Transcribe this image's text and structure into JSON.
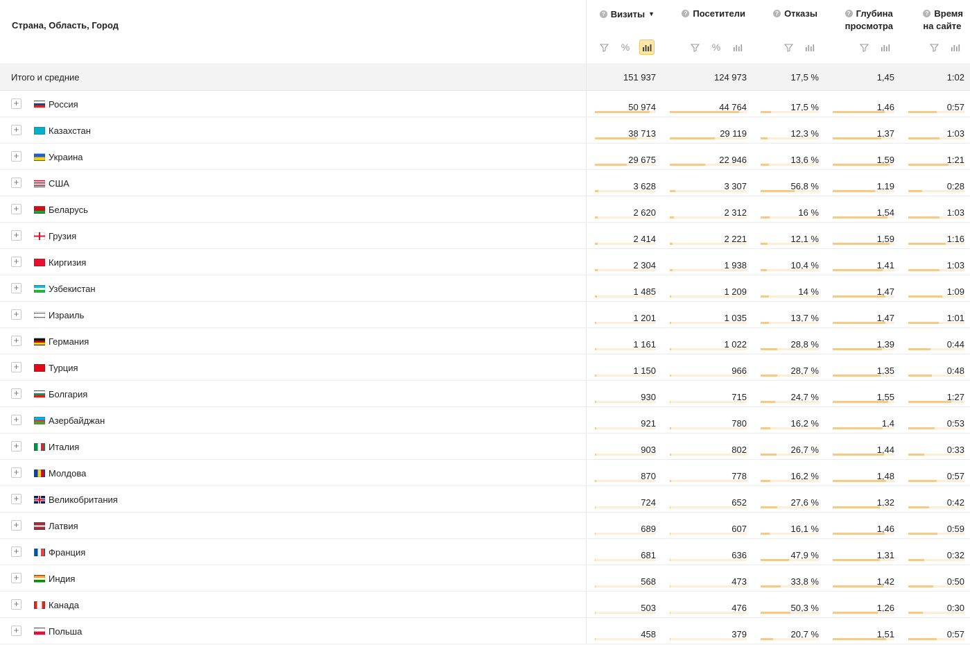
{
  "header": {
    "dimension_label": "Страна, Область, Город",
    "metrics": [
      {
        "label": "Визиты",
        "help_icon": "help-icon",
        "sort_icon": "sort-desc-icon",
        "tools": [
          "filter-icon",
          "percent-icon",
          "bar-chart-icon"
        ],
        "active_tool": "bar-chart-icon"
      },
      {
        "label": "Посетители",
        "help_icon": "help-icon",
        "tools": [
          "filter-icon",
          "percent-icon",
          "bar-chart-icon"
        ]
      },
      {
        "label": "Отказы",
        "help_icon": "help-icon",
        "tools": [
          "filter-icon",
          "bar-chart-icon"
        ]
      },
      {
        "label_line1": "Глубина",
        "label_line2": "просмотра",
        "help_icon": "help-icon",
        "tools": [
          "filter-icon",
          "bar-chart-icon"
        ]
      },
      {
        "label_line1": "Время",
        "label_line2": "на сайте",
        "help_icon": "help-icon",
        "tools": [
          "filter-icon",
          "bar-chart-icon"
        ]
      }
    ]
  },
  "totals": {
    "label": "Итого и средние",
    "values": [
      "151 937",
      "124 973",
      "17,5 %",
      "1,45",
      "1:02"
    ]
  },
  "colors": {
    "bar_fill": "#f1c992",
    "bar_track": "#fbeedb",
    "active_tool_bg": "#fde7a6",
    "totals_bg": "#f3f3f3"
  },
  "rows": [
    {
      "country": "Россия",
      "flag": "flag-ru",
      "values": [
        "50 974",
        "44 764",
        "17,5 %",
        "1,46",
        "0:57"
      ],
      "bars": [
        0.9,
        0.9,
        0.18,
        0.84,
        0.5
      ]
    },
    {
      "country": "Казахстан",
      "flag": "flag-kz",
      "values": [
        "38 713",
        "29 119",
        "12,3 %",
        "1,37",
        "1:03"
      ],
      "bars": [
        0.68,
        0.59,
        0.12,
        0.79,
        0.56
      ]
    },
    {
      "country": "Украина",
      "flag": "flag-ua",
      "values": [
        "29 675",
        "22 946",
        "13,6 %",
        "1,59",
        "1:21"
      ],
      "bars": [
        0.52,
        0.46,
        0.14,
        0.92,
        0.72
      ]
    },
    {
      "country": "США",
      "flag": "flag-us",
      "values": [
        "3 628",
        "3 307",
        "56,8 %",
        "1,19",
        "0:28"
      ],
      "bars": [
        0.06,
        0.07,
        0.58,
        0.69,
        0.25
      ]
    },
    {
      "country": "Беларусь",
      "flag": "flag-by",
      "values": [
        "2 620",
        "2 312",
        "16 %",
        "1,54",
        "1:03"
      ],
      "bars": [
        0.05,
        0.05,
        0.16,
        0.89,
        0.56
      ]
    },
    {
      "country": "Грузия",
      "flag": "flag-ge",
      "values": [
        "2 414",
        "2 221",
        "12,1 %",
        "1,59",
        "1:16"
      ],
      "bars": [
        0.04,
        0.04,
        0.12,
        0.92,
        0.67
      ]
    },
    {
      "country": "Киргизия",
      "flag": "flag-kg",
      "values": [
        "2 304",
        "1 938",
        "10,4 %",
        "1,41",
        "1:03"
      ],
      "bars": [
        0.04,
        0.04,
        0.11,
        0.81,
        0.56
      ]
    },
    {
      "country": "Узбекистан",
      "flag": "flag-uz",
      "values": [
        "1 485",
        "1 209",
        "14 %",
        "1,47",
        "1:09"
      ],
      "bars": [
        0.03,
        0.02,
        0.14,
        0.85,
        0.61
      ]
    },
    {
      "country": "Израиль",
      "flag": "flag-il",
      "values": [
        "1 201",
        "1 035",
        "13,7 %",
        "1,47",
        "1:01"
      ],
      "bars": [
        0.02,
        0.02,
        0.14,
        0.85,
        0.54
      ]
    },
    {
      "country": "Германия",
      "flag": "flag-de",
      "values": [
        "1 161",
        "1 022",
        "28,8 %",
        "1,39",
        "0:44"
      ],
      "bars": [
        0.02,
        0.02,
        0.29,
        0.8,
        0.39
      ]
    },
    {
      "country": "Турция",
      "flag": "flag-tr",
      "values": [
        "1 150",
        "966",
        "28,7 %",
        "1,35",
        "0:48"
      ],
      "bars": [
        0.02,
        0.02,
        0.29,
        0.78,
        0.42
      ]
    },
    {
      "country": "Болгария",
      "flag": "flag-bg",
      "values": [
        "930",
        "715",
        "24,7 %",
        "1,55",
        "1:27"
      ],
      "bars": [
        0.02,
        0.01,
        0.25,
        0.9,
        0.77
      ]
    },
    {
      "country": "Азербайджан",
      "flag": "flag-az",
      "values": [
        "921",
        "780",
        "16,2 %",
        "1,4",
        "0:53"
      ],
      "bars": [
        0.02,
        0.02,
        0.17,
        0.81,
        0.47
      ]
    },
    {
      "country": "Италия",
      "flag": "flag-it",
      "values": [
        "903",
        "802",
        "26,7 %",
        "1,44",
        "0:33"
      ],
      "bars": [
        0.02,
        0.02,
        0.27,
        0.83,
        0.29
      ]
    },
    {
      "country": "Молдова",
      "flag": "flag-md",
      "values": [
        "870",
        "778",
        "16,2 %",
        "1,48",
        "0:57"
      ],
      "bars": [
        0.02,
        0.02,
        0.17,
        0.86,
        0.5
      ]
    },
    {
      "country": "Великобритания",
      "flag": "flag-gb",
      "values": [
        "724",
        "652",
        "27,6 %",
        "1,32",
        "0:42"
      ],
      "bars": [
        0.01,
        0.01,
        0.28,
        0.76,
        0.37
      ]
    },
    {
      "country": "Латвия",
      "flag": "flag-lv",
      "values": [
        "689",
        "607",
        "16,1 %",
        "1,46",
        "0:59"
      ],
      "bars": [
        0.01,
        0.01,
        0.16,
        0.84,
        0.52
      ]
    },
    {
      "country": "Франция",
      "flag": "flag-fr",
      "values": [
        "681",
        "636",
        "47,9 %",
        "1,31",
        "0:32"
      ],
      "bars": [
        0.01,
        0.01,
        0.49,
        0.76,
        0.28
      ]
    },
    {
      "country": "Индия",
      "flag": "flag-in",
      "values": [
        "568",
        "473",
        "33,8 %",
        "1,42",
        "0:50"
      ],
      "bars": [
        0.01,
        0.01,
        0.34,
        0.82,
        0.44
      ]
    },
    {
      "country": "Канада",
      "flag": "flag-ca",
      "values": [
        "503",
        "476",
        "50,3 %",
        "1,26",
        "0:30"
      ],
      "bars": [
        0.01,
        0.01,
        0.51,
        0.73,
        0.26
      ]
    },
    {
      "country": "Польша",
      "flag": "flag-pl",
      "values": [
        "458",
        "379",
        "20,7 %",
        "1,51",
        "0:57"
      ],
      "bars": [
        0.01,
        0.01,
        0.21,
        0.87,
        0.5
      ]
    }
  ]
}
